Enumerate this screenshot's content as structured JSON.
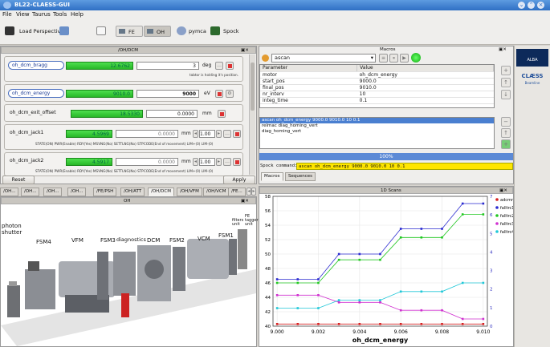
{
  "window": {
    "title": "BL22-CLAESS-GUI",
    "btn_min": "⌄",
    "btn_max": "⌃",
    "btn_close": "×"
  },
  "menu": [
    "File",
    "View",
    "Taurus",
    "Tools",
    "Help"
  ],
  "toolbar": {
    "load_perspectives": "Load Perspectives",
    "fe": "FE",
    "oh": "OH",
    "pymca": "pymca",
    "spock": "Spock"
  },
  "motor_panel": {
    "title": "/OH/DCM",
    "rows": [
      {
        "name": "oh_dcm_bragg",
        "readback": "12.6762",
        "setpoint": "3",
        "unit": "deg",
        "status": "tabtor is holding it's position."
      },
      {
        "name": "oh_dcm_energy",
        "readback": "9010.0",
        "setpoint": "9000",
        "unit": "eV"
      },
      {
        "name": "oh_dcm_exit_offset",
        "readback": "18.5330",
        "setpoint": "0.0000",
        "unit": "mm"
      },
      {
        "name": "oh_dcm_jack1",
        "readback": "4.5969",
        "setpoint": "0.0000",
        "unit": "mm",
        "step": "1.00",
        "status": "STATE(ON) PWR(Enable) RDY(Yes) MSVNG(No) SETTLNG(No) STPCODE(End of movement) LIM+(0) LIM-(0)"
      },
      {
        "name": "oh_dcm_jack2",
        "readback": "4.5917",
        "setpoint": "0.0000",
        "unit": "mm",
        "step": "1.00",
        "status": "STATE(ON) PWR(Enable) RDY(Yes) MSVNG(No) SETTLNG(No) STPCODE(End of movement) LIM+(0) LIM-(0)"
      }
    ],
    "reset": "Reset",
    "apply": "Apply"
  },
  "synoptic_tabs": [
    "/OH...",
    "/OH...",
    "/OH...",
    "/OH...",
    "/FE/PSH",
    "/OH/ATT",
    "/OH/DCM",
    "/OH/VFM",
    "/OH/VCM",
    "/FE..."
  ],
  "synoptic": {
    "title": "OH",
    "labels": {
      "photon_shutter": "photon\nshutter",
      "fsm4": "FSM4",
      "vfm": "VFM",
      "fsm3": "FSM3",
      "diagnostics": "diagnostics",
      "dcm": "DCM",
      "fsm2": "FSM2",
      "vcm": "VCM",
      "fsm1": "FSM1",
      "filters": "filters\nunit",
      "fe_tagger": "FE\ntagger\nunit"
    }
  },
  "macros": {
    "title": "Macros",
    "selected_macro": "ascan",
    "param_header": "Parameter",
    "value_header": "Value",
    "params": [
      [
        "motor",
        "oh_dcm_energy"
      ],
      [
        "start_pos",
        "9000.0"
      ],
      [
        "final_pos",
        "9010.0"
      ],
      [
        "nr_interv",
        "10"
      ],
      [
        "integ_time",
        "0.1"
      ]
    ],
    "history": [
      "ascan oh_dcm_energy 9000.0 9010.0 10 0.1",
      "relmac diag_homing_vert",
      "diag_homing_vert"
    ],
    "progress": "100%",
    "spock_label": "Spock command:",
    "spock_cmd": "ascan oh_dcm_energy 9000.0 9010.0 10 0.1",
    "tab_macros": "Macros",
    "tab_sequences": "Sequences"
  },
  "logos": {
    "alba": "ALBA",
    "claess": "CLÆSS",
    "beamline": "Beamline"
  },
  "chart_data": {
    "type": "line",
    "title": "1D Scans",
    "xlabel": "oh_dcm_energy",
    "x": [
      9000,
      9001,
      9002,
      9003,
      9004,
      9005,
      9006,
      9007,
      9008,
      9009,
      9010
    ],
    "xlim": [
      8999.8,
      9010.2
    ],
    "xticks": [
      "9.000",
      "9.002",
      "9.004",
      "9.006",
      "9.008",
      "9.010"
    ],
    "ylim": [
      40,
      58
    ],
    "y2lim": [
      0,
      7
    ],
    "yticks": [
      "40",
      "42",
      "44",
      "46",
      "48",
      "50",
      "52",
      "54",
      "56",
      "58"
    ],
    "y2ticks": [
      "0",
      "1",
      "2",
      "3",
      "4",
      "5",
      "6",
      "7"
    ],
    "legend_position": "top-right",
    "series": [
      {
        "name": "adcmr",
        "color": "#d62020",
        "axis": "y",
        "values": [
          40.3,
          40.3,
          40.3,
          40.3,
          40.3,
          40.3,
          40.3,
          40.3,
          40.3,
          40.3,
          40.3
        ]
      },
      {
        "name": "falltrc1",
        "color": "#2a2ad0",
        "axis": "y",
        "values": [
          46.5,
          46.5,
          46.5,
          50.0,
          50.0,
          50.0,
          53.5,
          53.5,
          53.5,
          57.0,
          57.0
        ]
      },
      {
        "name": "falltrc2",
        "color": "#22c722",
        "axis": "y",
        "values": [
          46.0,
          46.0,
          46.0,
          49.2,
          49.2,
          49.2,
          52.3,
          52.3,
          52.3,
          55.5,
          55.5
        ]
      },
      {
        "name": "falltrc3",
        "color": "#d030d0",
        "axis": "y",
        "values": [
          44.3,
          44.3,
          44.3,
          43.3,
          43.3,
          43.3,
          42.2,
          42.2,
          42.2,
          41.0,
          41.0
        ]
      },
      {
        "name": "falltrc4",
        "color": "#20c8d8",
        "axis": "y",
        "values": [
          42.5,
          42.5,
          42.5,
          43.6,
          43.6,
          43.6,
          44.8,
          44.8,
          44.8,
          46.0,
          46.0
        ]
      }
    ]
  }
}
